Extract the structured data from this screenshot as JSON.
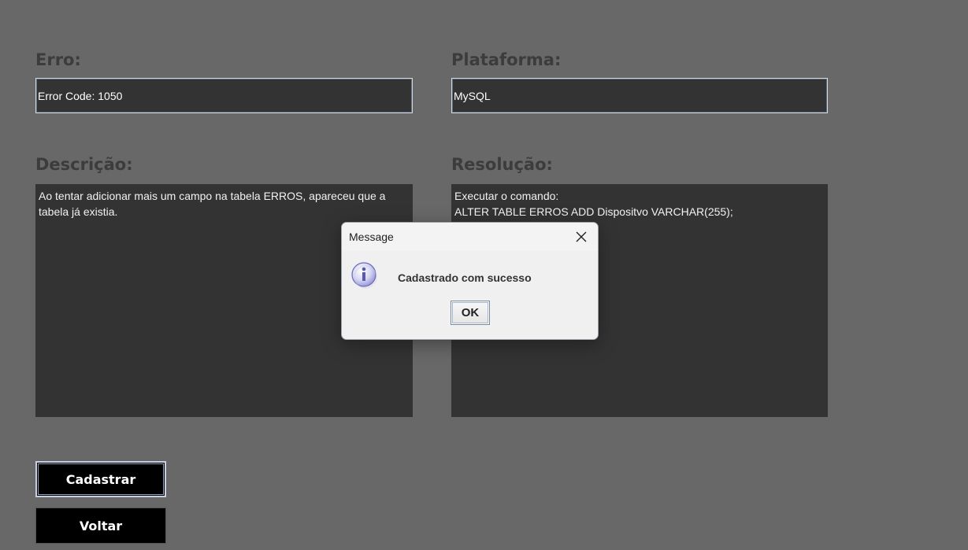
{
  "form": {
    "erro_label": "Erro:",
    "erro_value": "Error Code: 1050",
    "plataforma_label": "Plataforma:",
    "plataforma_value": "MySQL",
    "descricao_label": "Descrição:",
    "descricao_value": "Ao tentar adicionar mais um campo na tabela ERROS, apareceu que a tabela já existia.",
    "resolucao_label": "Resolução:",
    "resolucao_value": "Executar o comando:\nALTER TABLE ERROS ADD Dispositvo VARCHAR(255);"
  },
  "buttons": {
    "cadastrar": "Cadastrar",
    "voltar": "Voltar"
  },
  "dialog": {
    "title": "Message",
    "message": "Cadastrado com sucesso",
    "ok": "OK",
    "icon": "info-icon"
  },
  "colors": {
    "background": "#686868",
    "field_bg": "#333333",
    "button_bg": "#000000",
    "dialog_bg": "#f0f0f0"
  }
}
